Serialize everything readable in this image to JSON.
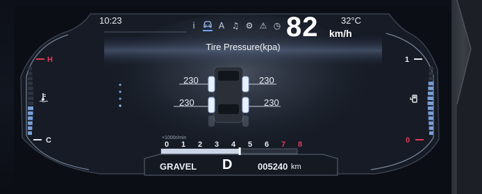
{
  "status_bar": {
    "time": "10:23",
    "temperature": "32°C",
    "speed": "82",
    "speed_unit": "km/h"
  },
  "menu_icons": [
    {
      "name": "info-icon",
      "glyph": "i",
      "active": false
    },
    {
      "name": "car-icon",
      "glyph": "🚙",
      "active": true
    },
    {
      "name": "navigation-icon",
      "glyph": "A",
      "active": false
    },
    {
      "name": "music-icon",
      "glyph": "♫",
      "active": false
    },
    {
      "name": "settings-icon",
      "glyph": "⚙",
      "active": false
    },
    {
      "name": "warning-icon",
      "glyph": "⚠",
      "active": false
    },
    {
      "name": "timer-icon",
      "glyph": "◷",
      "active": false
    }
  ],
  "main": {
    "title": "Tire Pressure(kpa)",
    "tire_pressures": {
      "front_left": "230",
      "front_right": "230",
      "rear_left": "230",
      "rear_right": "230"
    }
  },
  "temperature_gauge": {
    "high_label": "H",
    "low_label": "C",
    "level": 0.45,
    "icon": "coolant-temperature-icon"
  },
  "fuel_gauge": {
    "full_label": "1",
    "empty_label": "0",
    "level": 0.75,
    "icon": "fuel-pump-icon"
  },
  "tachometer": {
    "unit": "×1000r/min",
    "ticks": [
      "0",
      "1",
      "2",
      "3",
      "4",
      "5",
      "6",
      "7",
      "8"
    ],
    "redline_from": 7,
    "value": 4.6
  },
  "bottom_bar": {
    "drive_mode": "GRAVEL",
    "gear": "D",
    "odometer": "005240",
    "odometer_unit": "km"
  },
  "colors": {
    "accent_red": "#e23b57",
    "gauge_blue": "#7a9fd8",
    "active_icon": "#9ec6ff"
  }
}
